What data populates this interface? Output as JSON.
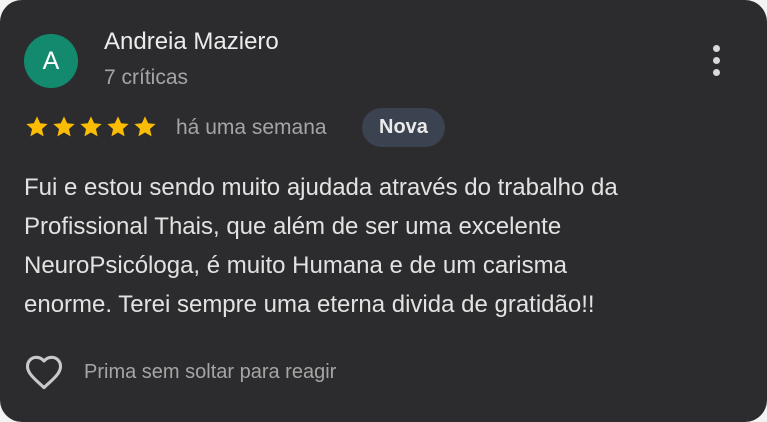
{
  "review": {
    "author": {
      "initial": "A",
      "name": "Andreia Maziero",
      "reviews_count": "7 críticas",
      "avatar_color": "#138a6e"
    },
    "menu_icon": "more-vert-icon",
    "rating": 5,
    "rating_max": 5,
    "star_color": "#fbbc04",
    "time": "há uma semana",
    "badge": "Nova",
    "text_lines": [
      "Fui e estou sendo muito ajudada através do trabalho da",
      "Profissional Thais, que além de ser uma excelente",
      "NeuroPsicóloga, é muito Humana e de um carisma",
      "enorme. Terei sempre uma eterna divida de gratidão!!"
    ],
    "react": {
      "icon": "heart-outline-icon",
      "label": "Prima sem soltar para reagir"
    }
  }
}
